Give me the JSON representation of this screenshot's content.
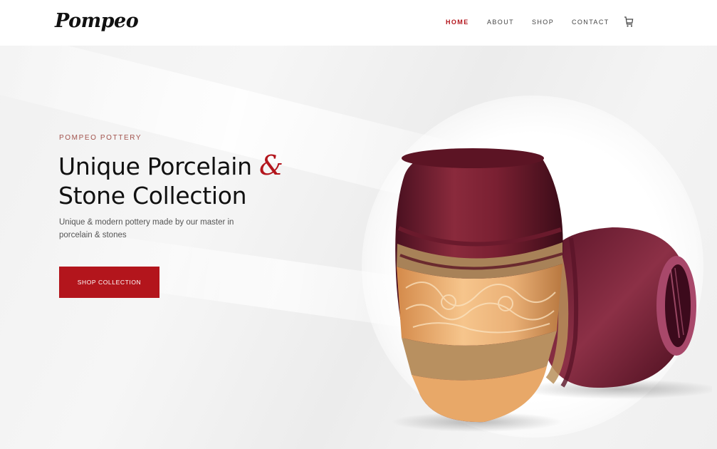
{
  "header": {
    "logo": "Pompeo",
    "nav": [
      {
        "label": "HOME",
        "active": true
      },
      {
        "label": "ABOUT",
        "active": false
      },
      {
        "label": "SHOP",
        "active": false
      },
      {
        "label": "CONTACT",
        "active": false
      }
    ],
    "cart_icon": "cart-icon"
  },
  "hero": {
    "eyebrow": "POMPEO POTTERY",
    "headline_line1": "Unique Porcelain",
    "headline_amp": "&",
    "headline_line2": "Stone Collection",
    "subtext": "Unique & modern pottery made by our master in porcelain & stones",
    "cta_label": "SHOP COLLECTION"
  },
  "colors": {
    "accent": "#b3151c",
    "vase_body": "#7a2032",
    "vase_band": "#e8a868",
    "background": "#f2f2f2"
  }
}
